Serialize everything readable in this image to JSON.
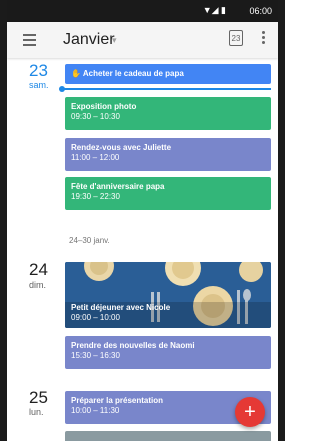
{
  "status": {
    "time": "06:00"
  },
  "appbar": {
    "month": "Janvier",
    "calendar_day": "23"
  },
  "days": [
    {
      "num": "23",
      "label": "sam."
    },
    {
      "num": "24",
      "label": "dim."
    },
    {
      "num": "25",
      "label": "lun."
    }
  ],
  "reminder": {
    "label": "Acheter le cadeau de papa"
  },
  "events": [
    {
      "title": "Exposition photo",
      "time": "09:30 – 10:30"
    },
    {
      "title": "Rendez-vous avec Juliette",
      "time": "11:00 – 12:00"
    },
    {
      "title": "Fête d'anniversaire papa",
      "time": "19:30 – 22:30"
    },
    {
      "title": "Petit déjeuner avec Nicole",
      "time": "09:00 – 10:00"
    },
    {
      "title": "Prendre des nouvelles de Naomi",
      "time": "15:30 – 16:30"
    },
    {
      "title": "Préparer la présentation",
      "time": "10:00 – 11:30"
    }
  ],
  "week_range": "24–30 janv.",
  "fab": {
    "label": "+"
  },
  "colors": {
    "blue": "#4285f4",
    "green": "#33b679",
    "purple": "#7986cb",
    "accent": "#1e88e5",
    "fab": "#e53935"
  }
}
